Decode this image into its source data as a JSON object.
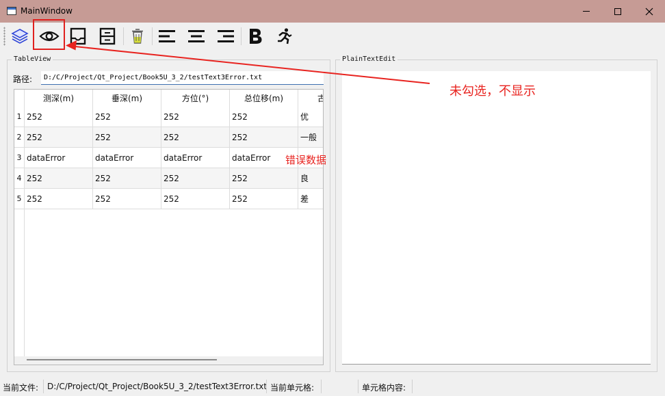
{
  "window": {
    "title": "MainWindow"
  },
  "table_view": {
    "group_title": "TableView",
    "path_label": "路径:",
    "path_value": "D:/C/Project/Qt_Project/Book5U_3_2/testText3Error.txt",
    "columns": [
      "测深(m)",
      "垂深(m)",
      "方位(°)",
      "总位移(m)",
      "古"
    ],
    "rows": [
      {
        "num": "1",
        "cells": [
          "252",
          "252",
          "252",
          "252",
          "优"
        ]
      },
      {
        "num": "2",
        "cells": [
          "252",
          "252",
          "252",
          "252",
          "一般"
        ]
      },
      {
        "num": "3",
        "cells": [
          "dataError",
          "dataError",
          "dataError",
          "dataError",
          ""
        ]
      },
      {
        "num": "4",
        "cells": [
          "252",
          "252",
          "252",
          "252",
          "良"
        ]
      },
      {
        "num": "5",
        "cells": [
          "252",
          "252",
          "252",
          "252",
          "差"
        ]
      }
    ]
  },
  "plain_text_edit": {
    "group_title": "PlainTextEdit",
    "content": ""
  },
  "annotations": {
    "main": "未勾选，不显示",
    "error_data": "错误数据",
    "color": "#e8231f"
  },
  "status_bar": {
    "current_file_label": "当前文件:",
    "current_file_value": "D:/C/Project/Qt_Project/Book5U_3_2/testText3Error.txt",
    "current_cell_label": "当前单元格:",
    "cell_content_label": "单元格内容:"
  },
  "toolbar_icons": [
    "layers-icon",
    "eye-icon",
    "tray-icon",
    "drawer-icon",
    "trash-icon",
    "align-left-icon",
    "align-center-icon",
    "align-right-icon",
    "bold-icon",
    "run-icon"
  ],
  "colors": {
    "titlebar": "#c69b95",
    "highlight": "#e0201e",
    "input_underline": "#3d6fb0"
  }
}
